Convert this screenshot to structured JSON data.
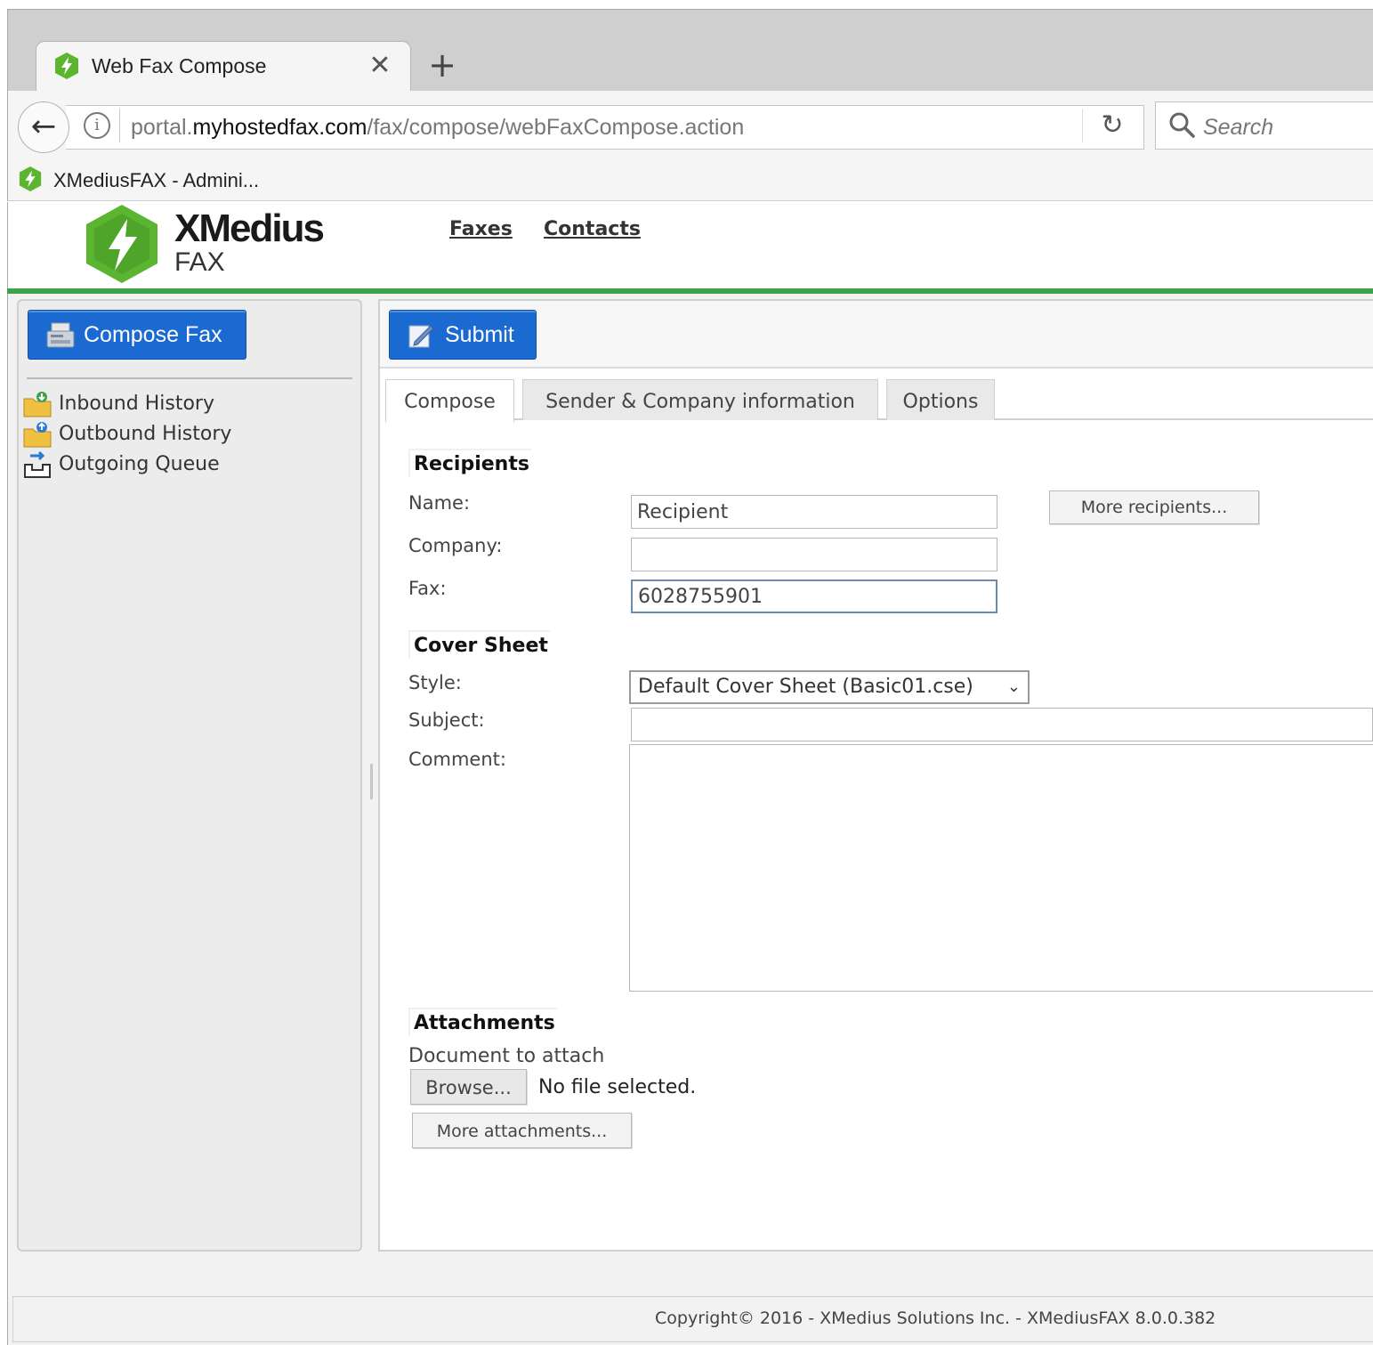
{
  "browser": {
    "tab_title": "Web Fax Compose",
    "tab_close": "✕",
    "new_tab": "+",
    "url_prefix": "portal.",
    "url_host": "myhostedfax.com",
    "url_path": "/fax/compose/webFaxCompose.action",
    "search_placeholder": "Search",
    "bookmark_title": "XMediusFAX - Admini...",
    "icons": [
      "xmedius-favicon",
      "back-arrow-icon",
      "info-icon",
      "reload-icon",
      "search-icon"
    ]
  },
  "app": {
    "logo_word": "XMedius",
    "logo_sub": "FAX",
    "nav": [
      {
        "label": "Faxes"
      },
      {
        "label": "Contacts"
      }
    ],
    "brand_green": "#3da24a",
    "button_blue": "#1a6ad1"
  },
  "sidebar": {
    "compose_label": "Compose Fax",
    "items": [
      {
        "label": "Inbound History",
        "icon": "folder-inbound-icon"
      },
      {
        "label": "Outbound History",
        "icon": "folder-outbound-icon"
      },
      {
        "label": "Outgoing Queue",
        "icon": "outbox-queue-icon"
      }
    ]
  },
  "toolbar": {
    "submit_label": "Submit"
  },
  "tabs": [
    {
      "label": "Compose",
      "active": true
    },
    {
      "label": "Sender & Company information",
      "active": false
    },
    {
      "label": "Options",
      "active": false
    }
  ],
  "recipients": {
    "title": "Recipients",
    "name_label": "Name:",
    "name_value": "Recipient",
    "company_label": "Company:",
    "company_value": "",
    "fax_label": "Fax:",
    "fax_value": "6028755901",
    "more_label": "More recipients..."
  },
  "cover": {
    "title": "Cover Sheet",
    "style_label": "Style:",
    "style_value": "Default Cover Sheet (Basic01.cse)",
    "subject_label": "Subject:",
    "subject_value": "",
    "comment_label": "Comment:"
  },
  "attachments": {
    "title": "Attachments",
    "doc_label": "Document to attach",
    "browse_label": "Browse...",
    "no_file": "No file selected.",
    "more_label": "More attachments..."
  },
  "footer": {
    "text": "Copyright© 2016 - XMedius Solutions Inc. - XMediusFAX 8.0.0.382"
  }
}
